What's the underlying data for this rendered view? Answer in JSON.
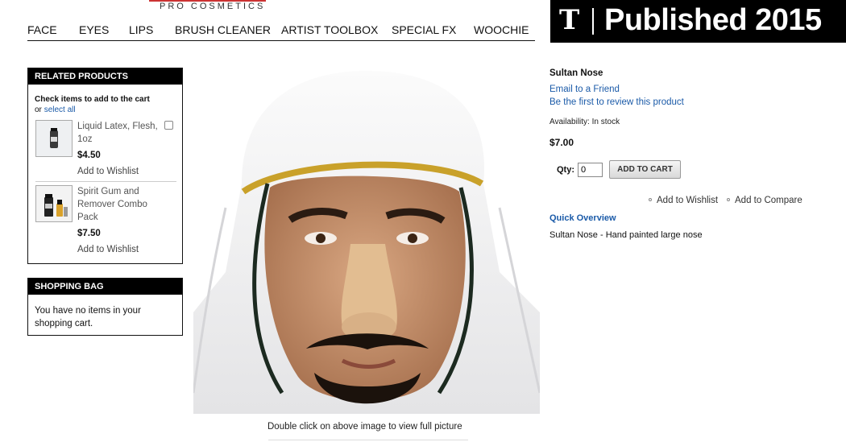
{
  "brand": {
    "subtitle": "PRO COSMETICS"
  },
  "nav": {
    "items": [
      {
        "label": "FACE"
      },
      {
        "label": "EYES"
      },
      {
        "label": "LIPS"
      },
      {
        "label": "BRUSH CLEANER"
      },
      {
        "label": "ARTIST TOOLBOX"
      },
      {
        "label": "SPECIAL FX"
      },
      {
        "label": "WOOCHIE"
      }
    ]
  },
  "banner": {
    "logo": "T",
    "text": "Published 2015"
  },
  "related": {
    "heading": "RELATED PRODUCTS",
    "intro": "Check items to add to the cart",
    "intro_or": "or",
    "select_all": "select all",
    "products": [
      {
        "name": "Liquid Latex, Flesh, 1oz",
        "price": "$4.50",
        "wishlist": "Add to Wishlist",
        "checked": false
      },
      {
        "name": "Spirit Gum and Remover Combo Pack",
        "price": "$7.50",
        "wishlist": "Add to Wishlist"
      }
    ]
  },
  "shopping_bag": {
    "heading": "SHOPPING BAG",
    "empty_text": "You have no items in your shopping cart."
  },
  "main_image": {
    "caption": "Double click on above image to view full picture"
  },
  "product": {
    "title": "Sultan Nose",
    "email_friend": "Email to a Friend",
    "review": "Be the first to review this product",
    "availability": "Availability: In stock",
    "price": "$7.00",
    "qty_label": "Qty:",
    "qty_value": "0",
    "add_to_cart": "ADD TO CART",
    "add_to_wishlist": "Add to Wishlist",
    "add_to_compare": "Add to Compare",
    "quick_overview_heading": "Quick Overview",
    "quick_overview_text": "Sultan Nose - Hand painted large nose"
  },
  "colors": {
    "link_blue": "#1a5aa8",
    "banner_black": "#000000",
    "box_header_black": "#000000"
  }
}
